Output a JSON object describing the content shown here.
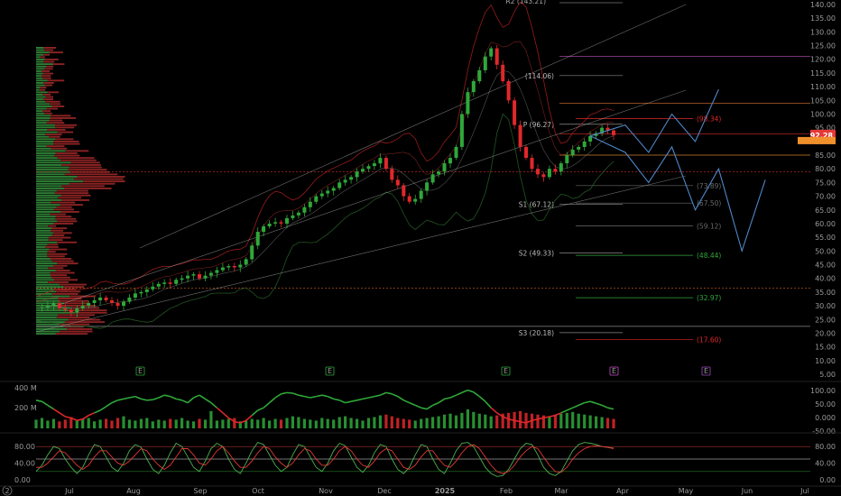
{
  "colors": {
    "background": "#000000",
    "up": "#2fa83a",
    "down": "#e0282b",
    "volume_profile_up": "#2f7f36",
    "volume_profile_down": "#8b2323",
    "price_badge": "#e53935",
    "badge_orange": "#f0902c",
    "forecast": "#4e86c6",
    "stoch_k": "#4caf50",
    "stoch_d": "#e53935"
  },
  "chart_data": [
    {
      "type": "candlestick",
      "panel": "price",
      "y_axis": {
        "min": 5,
        "max": 140,
        "ticks": [
          "140.00",
          "135.00",
          "130.00",
          "125.00",
          "120.00",
          "115.00",
          "110.00",
          "105.00",
          "100.00",
          "95.00",
          "90.00",
          "85.00",
          "80.00",
          "75.00",
          "70.00",
          "65.00",
          "60.00",
          "55.00",
          "50.00",
          "45.00",
          "40.00",
          "35.00",
          "30.00",
          "25.00",
          "20.00",
          "15.00",
          "10.00",
          "5.00"
        ]
      },
      "x_axis": {
        "labels": [
          "Jul",
          "Aug",
          "Sep",
          "Oct",
          "Nov",
          "Dec",
          "2025",
          "Feb",
          "Mar",
          "Apr",
          "May",
          "Jun",
          "Jul"
        ],
        "corner_label": "2"
      },
      "last_price": "92.28",
      "close_series": [
        29,
        29.5,
        30,
        31,
        29,
        28.5,
        27.5,
        29,
        30,
        31,
        32,
        33,
        32,
        31,
        30,
        31.5,
        33,
        34.5,
        35,
        36,
        37,
        38,
        38.5,
        38,
        39.5,
        40,
        41,
        41.5,
        40,
        41,
        42,
        43,
        44,
        44.5,
        44,
        45,
        47,
        52,
        57,
        59,
        60,
        60.5,
        60,
        62,
        63,
        64,
        66,
        68,
        70,
        71,
        72,
        73,
        75,
        76,
        77,
        79,
        80,
        81,
        82,
        84,
        80,
        76,
        74,
        70,
        68,
        69,
        72,
        75,
        78,
        79,
        82,
        84,
        88,
        100,
        108,
        112,
        116,
        121,
        124,
        118,
        112,
        105,
        96,
        88,
        84,
        80,
        78,
        77,
        80,
        79,
        82,
        85,
        87,
        88,
        90,
        92,
        93,
        95,
        94,
        92.28
      ],
      "pivot_levels": [
        {
          "label": "R2 (143.21)",
          "value": 143.21
        },
        {
          "label": "(114.06)",
          "value": 114.06
        },
        {
          "label": "P (96.27)",
          "value": 96.27
        },
        {
          "label": "S1 (67.12)",
          "value": 67.12
        },
        {
          "label": "S2 (49.33)",
          "value": 49.33
        },
        {
          "label": "S3 (20.18)",
          "value": 20.18
        }
      ],
      "fib_levels": [
        {
          "label": "(98.34)",
          "value": 98.34,
          "color": "#e0282b"
        },
        {
          "label": "(73.89)",
          "value": 73.89,
          "color": "#6a6a6a"
        },
        {
          "label": "(67.50)",
          "value": 67.5,
          "color": "#6a6a6a"
        },
        {
          "label": "(59.12)",
          "value": 59.12,
          "color": "#6a6a6a"
        },
        {
          "label": "(48.44)",
          "value": 48.44,
          "color": "#2fa83a"
        },
        {
          "label": "(32.97)",
          "value": 32.97,
          "color": "#2fa83a"
        },
        {
          "label": "(17.60)",
          "value": 17.6,
          "color": "#e0282b"
        }
      ],
      "forecast_paths": [
        [
          [
            95,
            92
          ],
          [
            101,
            86
          ],
          [
            105,
            75
          ],
          [
            109,
            88
          ],
          [
            113,
            65
          ],
          [
            117,
            80
          ],
          [
            121,
            50
          ],
          [
            125,
            76
          ]
        ],
        [
          [
            95,
            92
          ],
          [
            101,
            96
          ],
          [
            105,
            86
          ],
          [
            109,
            100
          ],
          [
            113,
            90
          ],
          [
            117,
            109
          ]
        ]
      ],
      "earnings_marker": "E"
    },
    {
      "type": "line",
      "panel": "volume",
      "y_axis_left": [
        "400 M",
        "200 M"
      ],
      "y_axis_right": [
        "100.00",
        "50.00",
        "0.000",
        "-50.00"
      ],
      "oscillator": [
        40,
        35,
        20,
        5,
        -10,
        -25,
        -30,
        -40,
        -35,
        -20,
        -10,
        0,
        15,
        30,
        40,
        45,
        50,
        55,
        45,
        40,
        42,
        50,
        60,
        55,
        45,
        40,
        30,
        50,
        60,
        45,
        30,
        10,
        -10,
        -30,
        -45,
        -50,
        -40,
        -20,
        0,
        10,
        30,
        50,
        65,
        70,
        68,
        60,
        55,
        50,
        55,
        60,
        55,
        45,
        40,
        30,
        35,
        40,
        45,
        50,
        55,
        60,
        70,
        65,
        55,
        40,
        30,
        20,
        10,
        5,
        20,
        30,
        45,
        50,
        60,
        70,
        80,
        72,
        55,
        35,
        10,
        -10,
        -25,
        -35,
        -40,
        -45,
        -50,
        -40,
        -35,
        -30,
        -25,
        -20,
        -10,
        0,
        10,
        20,
        30,
        35,
        28,
        20,
        10,
        5
      ],
      "volume": [
        50,
        60,
        45,
        55,
        40,
        50,
        65,
        45,
        55,
        60,
        40,
        50,
        55,
        45,
        60,
        70,
        50,
        45,
        55,
        60,
        40,
        50,
        45,
        55,
        50,
        60,
        45,
        40,
        55,
        50,
        100,
        45,
        50,
        55,
        60,
        40,
        45,
        55,
        50,
        60,
        45,
        55,
        50,
        60,
        70,
        65,
        55,
        50,
        45,
        60,
        55,
        50,
        65,
        70,
        60,
        55,
        45,
        60,
        65,
        75,
        80,
        70,
        60,
        55,
        50,
        45,
        55,
        60,
        65,
        70,
        80,
        85,
        75,
        90,
        110,
        95,
        85,
        80,
        70,
        75,
        85,
        90,
        95,
        100,
        90,
        85,
        80,
        75,
        70,
        80,
        85,
        90,
        95,
        85,
        80,
        75,
        70,
        65,
        60,
        55
      ]
    },
    {
      "type": "line",
      "panel": "stochastic",
      "y_axis": [
        "80.00",
        "40.00",
        "0.00"
      ],
      "series": [
        {
          "values": [
            20,
            35,
            60,
            80,
            75,
            50,
            30,
            15,
            30,
            60,
            85,
            80,
            55,
            30,
            20,
            40,
            70,
            85,
            78,
            50,
            25,
            15,
            35,
            65,
            88,
            80,
            55,
            30,
            20,
            45,
            75,
            88,
            80,
            50,
            25,
            15,
            40,
            70,
            90,
            85,
            60,
            35,
            20,
            30,
            60,
            85,
            80,
            55,
            30,
            20,
            40,
            70,
            88,
            82,
            55,
            30,
            18,
            35,
            65,
            85,
            80,
            50,
            25,
            15,
            30,
            60,
            85,
            80,
            50,
            25,
            15,
            40,
            70,
            88,
            90,
            80,
            55,
            30,
            15,
            8,
            10,
            25,
            50,
            75,
            88,
            85,
            60,
            30,
            15,
            10,
            20,
            45,
            70,
            85,
            90,
            88,
            85,
            80,
            78,
            76
          ]
        },
        {
          "values": [
            30,
            30,
            40,
            55,
            70,
            65,
            50,
            35,
            25,
            35,
            55,
            70,
            70,
            55,
            40,
            35,
            45,
            60,
            75,
            70,
            50,
            35,
            25,
            35,
            55,
            75,
            75,
            60,
            40,
            35,
            50,
            70,
            80,
            65,
            45,
            30,
            30,
            45,
            65,
            80,
            75,
            55,
            40,
            30,
            40,
            60,
            75,
            70,
            50,
            35,
            35,
            50,
            70,
            80,
            70,
            50,
            35,
            30,
            45,
            65,
            75,
            70,
            50,
            30,
            25,
            35,
            55,
            70,
            70,
            50,
            35,
            30,
            45,
            65,
            80,
            85,
            75,
            55,
            35,
            20,
            15,
            20,
            35,
            55,
            70,
            80,
            75,
            55,
            35,
            20,
            18,
            30,
            50,
            65,
            75,
            80,
            82,
            80,
            78,
            75
          ]
        }
      ],
      "bands": [
        80,
        50,
        20
      ]
    }
  ]
}
